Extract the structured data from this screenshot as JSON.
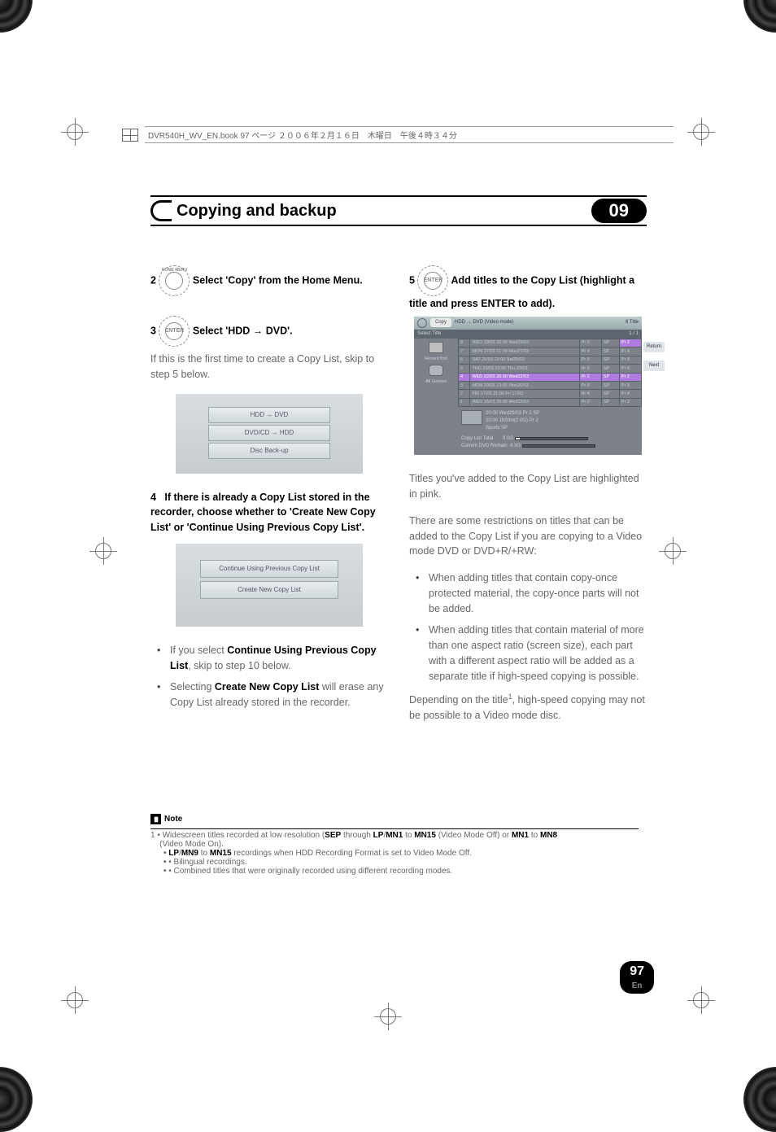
{
  "print_header": {
    "text": "DVR540H_WV_EN.book  97 ページ  ２００６年２月１６日　木曜日　午後４時３４分"
  },
  "section": {
    "title": "Copying and backup",
    "chapter": "09"
  },
  "left_col": {
    "step2_num": "2",
    "step2_icon_label": "HOME MENU",
    "step2_text": "Select 'Copy' from the Home Menu.",
    "step3_num": "3",
    "step3_icon_label": "ENTER",
    "step3_text": "Select 'HDD → DVD'.",
    "step3_body": "If this is the first time to create a Copy List, skip to step 5 below.",
    "ui1": {
      "opt1": "HDD → DVD",
      "opt2": "DVD/CD → HDD",
      "opt3": "Disc Back-up"
    },
    "step4_num": "4",
    "step4_text": "If there is already a Copy List stored in the recorder, choose whether to 'Create New Copy List' or 'Continue Using Previous Copy List'.",
    "ui2": {
      "opt1": "Continue Using Previous Copy List",
      "opt2": "Create New Copy List"
    },
    "bullets": [
      {
        "pre": "If you select ",
        "strong": "Continue Using Previous Copy List",
        "post": ", skip to step 10 below."
      },
      {
        "pre": "Selecting ",
        "strong": "Create New Copy List",
        "post": " will erase any Copy List already stored in the recorder."
      }
    ]
  },
  "right_col": {
    "step5_num": "5",
    "step5_icon_label": "ENTER",
    "step5_text": "Add titles to the Copy List (highlight a title and press ENTER to add).",
    "copy_ui": {
      "tab_copy": "Copy",
      "mode": "HDD → DVD (Video mode)",
      "titlecount": "8  Title",
      "select_title": "Select Title",
      "pager": "1 / 1",
      "left_labels": {
        "recent": "Recent first",
        "genres": "All Genres"
      },
      "rows": [
        [
          "8",
          "WED 29/03 20:00 Wed29/03",
          "Pr 2",
          "SP",
          "Pr 2"
        ],
        [
          "7",
          "MON 27/03 21:00 Mon27/03",
          "Pr 4",
          "SP",
          "Pr 4"
        ],
        [
          "6",
          "SAT 25/03 23:00 Sat25/03",
          "Pr 9",
          "SP",
          "Pr 9"
        ],
        [
          "5",
          "THU 23/03 22:00 Thu 23/03",
          "Pr 6",
          "SP",
          "Pr 6"
        ],
        [
          "4",
          "WED 22/03 20:00 Wed22/03",
          "Pr 2",
          "SP",
          "Pr 2"
        ],
        [
          "3",
          "MON 20/03 13:00 Mon20/03",
          "Pr 9",
          "SP",
          "Pr 9"
        ],
        [
          "2",
          "FRI  17/03 21:00 Fri 17/03",
          "Pr 4",
          "SP",
          "Pr 4"
        ],
        [
          "1",
          "WED 15/03 20:00 Wed15/03",
          "Pr 2",
          "SP",
          "Pr 2"
        ]
      ],
      "side": {
        "return": "Return",
        "next": "Next"
      },
      "detail_l1": "20:00    Wed29/03    Pr 2   SP",
      "detail_l2": "20:00        1h00m(2.0G)            Pr 2",
      "detail_l3": "               Sports        SP",
      "total_label": "Copy List Total",
      "total_val": "0.0G",
      "remain_label": "Current DVD Remain",
      "remain_val": "4.3G"
    },
    "after_ui_1": "Titles you've added to the Copy List are highlighted in pink.",
    "after_ui_2": "There are some restrictions on titles that can be added to the Copy List if you are copying to a Video mode DVD or DVD+R/+RW:",
    "bullets": [
      "When adding titles that contain copy-once protected material, the copy-once parts will not be added.",
      "When adding titles that contain material of more than one aspect ratio (screen size), each part with a different aspect ratio will be added as a separate title if high-speed copying is possible."
    ],
    "closing_pre": "Depending on the title",
    "closing_sup": "1",
    "closing_post": ", high-speed copying may not be possible to a Video mode disc."
  },
  "notes": {
    "label": "Note",
    "num": "1",
    "line1_pre": "• Widescreen titles recorded at low resolution (",
    "line1_b1": "SEP",
    "line1_mid1": " through ",
    "line1_b2": "LP",
    "line1_slash1": "/",
    "line1_b3": "MN1",
    "line1_mid2": " to ",
    "line1_b4": "MN15",
    "line1_mid3": " (Video Mode Off) or ",
    "line1_b5": "MN1",
    "line1_mid4": " to ",
    "line1_b6": "MN8",
    "line1_post": " (Video Mode On).",
    "line2_pre": "• ",
    "line2_b1": "LP",
    "line2_slash": "/",
    "line2_b2": "MN9",
    "line2_mid": " to ",
    "line2_b3": "MN15",
    "line2_post": " recordings when HDD Recording Format is set to Video Mode Off.",
    "line3": "• Bilingual recordings.",
    "line4": "• Combined titles that were originally recorded using different recording modes."
  },
  "pagenum": {
    "num": "97",
    "lang": "En"
  }
}
